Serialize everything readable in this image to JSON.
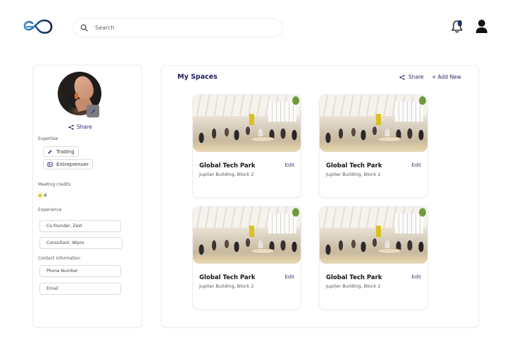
{
  "header": {
    "logo_icon": "infinity-logo-icon",
    "search": {
      "placeholder": "Search",
      "value": "",
      "icon": "search-icon"
    },
    "notification_icon": "bell-icon",
    "notification_badge_color": "#1f2a9e",
    "profile_icon": "user-icon"
  },
  "profile": {
    "avatar": "profile-photo",
    "edit_icon": "pencil-icon",
    "share_label": "Share",
    "expertise_label": "Expertise",
    "expertise": [
      {
        "label": "Trading",
        "icon": "pencil-icon"
      },
      {
        "label": "Entreprenuer",
        "icon": "image-icon"
      }
    ],
    "meeting_credits_label": "Meeting credits",
    "meeting_credits_value": "4",
    "experience_label": "Experience",
    "experience": [
      "Co-founder, Zest",
      "Consultant, Wipro"
    ],
    "contact_label": "Contact information",
    "contact": [
      "Phone Number",
      "Email"
    ]
  },
  "spaces": {
    "title": "My Spaces",
    "share_label": "Share",
    "add_new_label": "+ Add New",
    "cards": [
      {
        "title": "Global Tech Park",
        "subtitle": "Jupiter Building,  Block 2",
        "edit_label": "Edit"
      },
      {
        "title": "Global Tech Park",
        "subtitle": "Jupiter Building,  Block 2",
        "edit_label": "Edit"
      },
      {
        "title": "Global Tech Park",
        "subtitle": "Jupiter Building,  Block 2",
        "edit_label": "Edit"
      },
      {
        "title": "Global Tech Park",
        "subtitle": "Jupiter Building,  Block 2",
        "edit_label": "Edit"
      }
    ]
  },
  "colors": {
    "brand_navy": "#1d1b5e",
    "accent_blue": "#2f7fc4",
    "credit_dot": "#c8c21a"
  }
}
